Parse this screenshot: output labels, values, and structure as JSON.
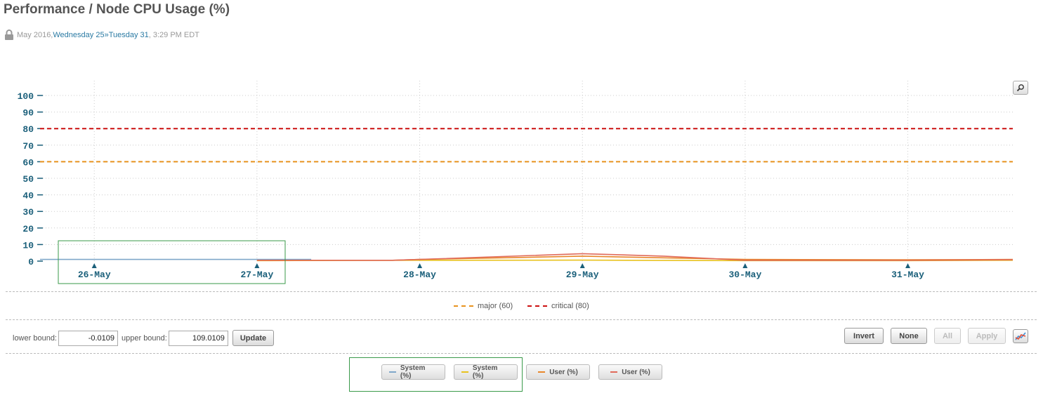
{
  "page": {
    "title": "Performance / Node CPU Usage (%)",
    "range": {
      "prefix": "May 2016, ",
      "start": "Wednesday 25",
      "sep": " » ",
      "end": "Tuesday 31",
      "suffix": ", 3:29 PM EDT"
    }
  },
  "icons": {
    "lock": "lock-icon",
    "zoom": "zoom-icon",
    "trend": "trend-chart-icon"
  },
  "colors": {
    "axis_text": "#1a5f7a",
    "major": "#e8931e",
    "critical": "#cc1111",
    "system_blue": "#7fa7c9",
    "system_yellow": "#e8c21e",
    "user_orange": "#e8872a",
    "user_red": "#e06a5a",
    "selection": "#3a9a4a"
  },
  "thresholds": {
    "major_label": "major (60)",
    "critical_label": "critical (80)"
  },
  "bounds": {
    "lower_label": "lower bound:",
    "lower_value": "-0.0109",
    "upper_label": "upper bound:",
    "upper_value": "109.0109",
    "update_label": "Update"
  },
  "actions": {
    "invert": "Invert",
    "none": "None",
    "all": "All",
    "apply": "Apply"
  },
  "series_buttons": [
    {
      "label": "System (%)",
      "color": "#7fa7c9"
    },
    {
      "label": "System (%)",
      "color": "#e8c21e"
    },
    {
      "label": "User (%)",
      "color": "#e8872a"
    },
    {
      "label": "User (%)",
      "color": "#e06a5a"
    }
  ],
  "chart_data": {
    "type": "line",
    "title": "Performance / Node CPU Usage (%)",
    "xlabel": "",
    "ylabel": "",
    "ylim": [
      0,
      100
    ],
    "yticks": [
      0,
      10,
      20,
      30,
      40,
      50,
      60,
      70,
      80,
      90,
      100
    ],
    "xticks": [
      "26-May",
      "27-May",
      "28-May",
      "29-May",
      "30-May",
      "31-May"
    ],
    "xlim": [
      "25-May 16:00",
      "31-May 15:29"
    ],
    "grid": true,
    "thresholds": [
      {
        "name": "major (60)",
        "value": 60,
        "color": "#e8931e"
      },
      {
        "name": "critical (80)",
        "value": 80,
        "color": "#cc1111"
      }
    ],
    "series": [
      {
        "name": "System (%)",
        "color": "#7fa7c9",
        "x": [
          "25-May 16:00",
          "26-May 00:00",
          "26-May 12:00",
          "27-May 00:00",
          "27-May 08:00"
        ],
        "values": [
          1.0,
          1.0,
          1.0,
          1.0,
          1.0
        ]
      },
      {
        "name": "System (%)",
        "color": "#e8c21e",
        "x": [
          "27-May 00:00",
          "28-May 00:00",
          "29-May 00:00",
          "30-May 00:00",
          "31-May 00:00",
          "31-May 15:29"
        ],
        "values": [
          0.3,
          0.5,
          0.6,
          0.3,
          0.3,
          0.5
        ]
      },
      {
        "name": "User (%)",
        "color": "#e8872a",
        "x": [
          "27-May 00:00",
          "27-May 20:00",
          "28-May 00:00",
          "28-May 12:00",
          "29-May 00:00",
          "29-May 12:00",
          "30-May 00:00",
          "31-May 00:00",
          "31-May 15:29"
        ],
        "values": [
          0.5,
          0.5,
          1.0,
          2.0,
          3.0,
          2.0,
          1.0,
          0.8,
          1.0
        ]
      },
      {
        "name": "User (%)",
        "color": "#e06a5a",
        "x": [
          "27-May 00:00",
          "27-May 20:00",
          "28-May 00:00",
          "29-May 00:00",
          "29-May 12:00",
          "30-May 00:00",
          "31-May 00:00",
          "31-May 15:29"
        ],
        "values": [
          0.5,
          0.5,
          1.0,
          4.5,
          3.0,
          0.5,
          0.5,
          0.8
        ]
      }
    ]
  }
}
